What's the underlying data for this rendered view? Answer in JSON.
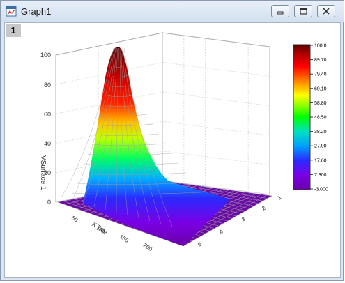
{
  "window": {
    "title": "Graph1",
    "layer_label": "1"
  },
  "icons": {
    "app": "graph-window-icon",
    "minimize": "minimize-icon",
    "restore": "restore-icon",
    "close": "close-icon"
  },
  "colors": {
    "peak": "#6a0000",
    "mid": "#00ff00",
    "base": "#6a00a8",
    "mesh": "#8c8c8c"
  },
  "chart_data": {
    "type": "surface",
    "title": "",
    "xlabel": "X Title",
    "ylabel": "",
    "zlabel": "VSurface 1",
    "x_ticks": [
      "50",
      "100",
      "150",
      "200"
    ],
    "y_ticks": [
      "5",
      "4",
      "3",
      "2",
      "1"
    ],
    "z_ticks": [
      "0",
      "20",
      "40",
      "60",
      "80",
      "100"
    ],
    "zlim": [
      0,
      100
    ],
    "colorbar": {
      "levels": [
        "100.0",
        "89.70",
        "79.40",
        "69.10",
        "58.80",
        "48.50",
        "38.20",
        "27.90",
        "17.60",
        "7.300",
        "-3.000"
      ],
      "min": -3.0,
      "max": 100.0
    },
    "peak": {
      "x": 20,
      "y": 1,
      "z": 100
    }
  }
}
